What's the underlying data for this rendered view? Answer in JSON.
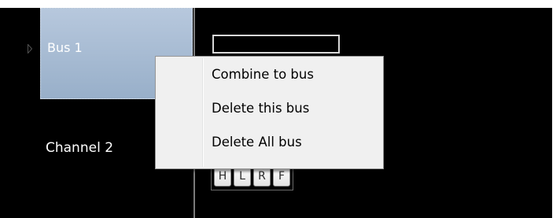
{
  "rows": {
    "bus": {
      "label": "Bus 1",
      "arrow_icon": "row-indicator-arrow-icon"
    },
    "channel": {
      "label": "Channel 2"
    }
  },
  "buttons": [
    {
      "label": "H"
    },
    {
      "label": "L"
    },
    {
      "label": "R"
    },
    {
      "label": "F"
    }
  ],
  "context_menu": {
    "items": [
      {
        "label": "Combine to bus"
      },
      {
        "label": "Delete this bus"
      },
      {
        "label": "Delete All bus"
      }
    ]
  },
  "colors": {
    "background": "#000000",
    "selected_row": "#a8bcd4",
    "menu_background": "#f0f0f0"
  }
}
